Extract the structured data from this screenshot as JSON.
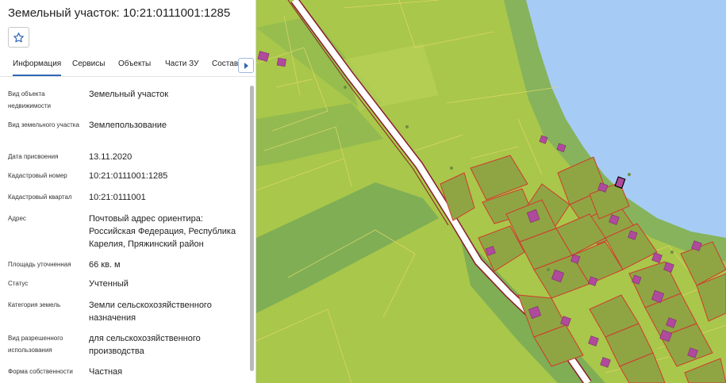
{
  "panel": {
    "title": "Земельный участок: 10:21:0111001:1285",
    "favorite_icon": "star-icon",
    "tabs": [
      {
        "label": "Информация",
        "active": true
      },
      {
        "label": "Сервисы",
        "active": false
      },
      {
        "label": "Объекты",
        "active": false
      },
      {
        "label": "Части ЗУ",
        "active": false
      },
      {
        "label": "Состав",
        "active": false
      }
    ],
    "tabs_next_icon": "chevron-right-icon",
    "properties": [
      {
        "label": "Вид объекта недвижимости",
        "value": "Земельный участок"
      },
      {
        "label": "Вид земельного участка",
        "value": "Землепользование"
      },
      {
        "label": "Дата присвоения",
        "value": "13.11.2020"
      },
      {
        "label": "Кадастровый номер",
        "value": "10:21:0111001:1285"
      },
      {
        "label": "Кадастровый квартал",
        "value": "10:21:0111001"
      },
      {
        "label": "Адрес",
        "value": "Почтовый адрес ориентира: Российская Федерация, Республика Карелия, Пряжинский район"
      },
      {
        "label": "Площадь уточненная",
        "value": "66 кв. м"
      },
      {
        "label": "Статус",
        "value": "Учтенный"
      },
      {
        "label": "Категория земель",
        "value": "Земли сельскохозяйственного назначения"
      },
      {
        "label": "Вид разрешенного использования",
        "value": "для сельскохозяйственного производства"
      },
      {
        "label": "Форма собственности",
        "value": "Частная"
      }
    ]
  },
  "map": {
    "colors": {
      "land": "#a9c74a",
      "water": "#a6ccf5",
      "shore": "#86b35b",
      "forest_strip": "#7fae55",
      "road": "#ffffff",
      "road_border": "#8b1d2c",
      "parcel": "#8fa543",
      "parcel_border": "#d13a2e",
      "building": "#b04a9c",
      "grid_line": "#e0d66c"
    }
  }
}
